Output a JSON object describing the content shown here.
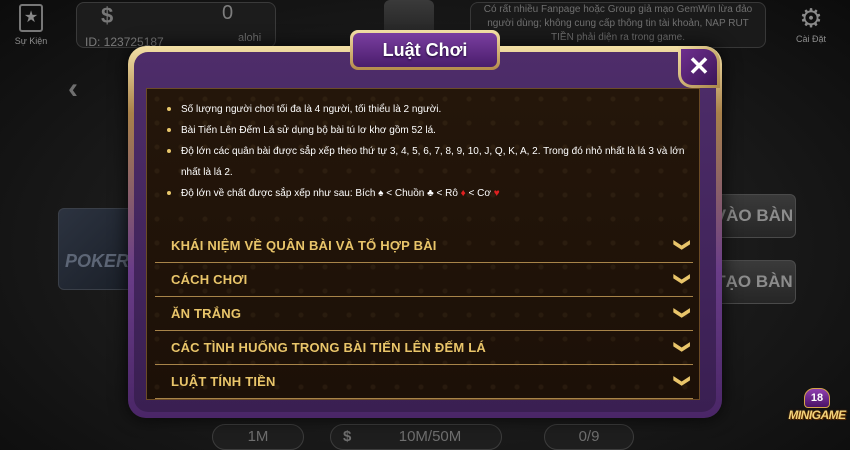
{
  "background": {
    "event_label": "Sự Kiện",
    "user_id": "ID: 123725187",
    "coins": "0",
    "player_name": "alohi",
    "notice": "Có rất nhiều Fanpage hoặc Group giả mạo GemWin lừa đảo người dùng; không cung cấp thông tin tài khoản, NAP RUT TIỀN phải diện ra trong game.",
    "settings_label": "Cài Đặt",
    "poker_label": "POKER",
    "join_button": "VÀO BÀN",
    "create_button": "TẠO BÀN",
    "bet_value": "1M",
    "range_value": "10M/50M",
    "players_value": "0/9",
    "minigame_badge": "18",
    "minigame_label": "MINIGAME"
  },
  "modal": {
    "title": "Luật Chơi",
    "close_label": "✕",
    "rules": [
      "Số lượng người chơi tối đa là 4 người, tối thiểu là 2 người.",
      "Bài Tiến Lên Đếm Lá sử dụng bộ bài tú lơ khơ gồm 52 lá.",
      "Độ lớn các quân bài được sắp xếp theo thứ tự 3, 4, 5, 6, 7, 8, 9, 10, J, Q, K, A, 2. Trong đó nhỏ nhất là lá 3 và lớn nhất là lá 2."
    ],
    "suit_rule": {
      "prefix": "Độ lớn về chất được sắp xếp như sau: Bích",
      "spade": "♠",
      "sep1": " < Chuồn",
      "club": "♣",
      "sep2": " < Rô",
      "diamond": "♦",
      "sep3": " < Cơ",
      "heart": "♥"
    },
    "sections": [
      "KHÁI NIỆM VỀ QUÂN BÀI VÀ TỔ HỢP BÀI",
      "CÁCH CHƠI",
      "ĂN TRẮNG",
      "CÁC TÌNH HUỐNG TRONG BÀI TIẾN LÊN ĐẾM LÁ",
      "LUẬT TÍNH TIỀN"
    ],
    "chevron": "❯"
  }
}
